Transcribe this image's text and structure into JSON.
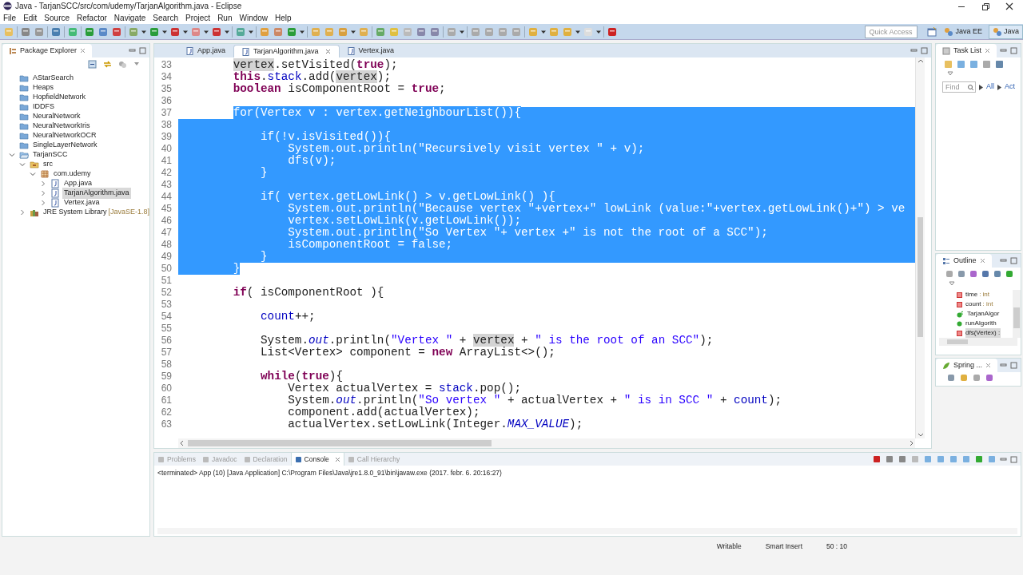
{
  "window": {
    "title": "Java - TarjanSCC/src/com/udemy/TarjanAlgorithm.java - Eclipse"
  },
  "menu": [
    "File",
    "Edit",
    "Source",
    "Refactor",
    "Navigate",
    "Search",
    "Project",
    "Run",
    "Window",
    "Help"
  ],
  "toolbar": {
    "quick_access": {
      "placeholder": "Quick Access"
    },
    "perspectives": [
      {
        "label": "Java EE",
        "selected": false
      },
      {
        "label": "Java",
        "selected": true
      }
    ]
  },
  "package_explorer": {
    "title": "Package Explorer",
    "tree": [
      {
        "label": "AStarSearch",
        "kind": "project"
      },
      {
        "label": "Heaps",
        "kind": "project"
      },
      {
        "label": "HopfieldNetwork",
        "kind": "project"
      },
      {
        "label": "IDDFS",
        "kind": "project"
      },
      {
        "label": "NeuralNetwork",
        "kind": "project"
      },
      {
        "label": "NeuralNetworkIris",
        "kind": "project"
      },
      {
        "label": "NeuralNetworkOCR",
        "kind": "project"
      },
      {
        "label": "SingleLayerNetwork",
        "kind": "project"
      },
      {
        "label": "TarjanSCC",
        "kind": "project",
        "expanded": true,
        "children": [
          {
            "label": "src",
            "kind": "folder",
            "expanded": true,
            "children": [
              {
                "label": "com.udemy",
                "kind": "package",
                "expanded": true,
                "children": [
                  {
                    "label": "App.java",
                    "kind": "file",
                    "expanded": false,
                    "selected": false
                  },
                  {
                    "label": "TarjanAlgorithm.java",
                    "kind": "file",
                    "expanded": false,
                    "selected": true
                  },
                  {
                    "label": "Vertex.java",
                    "kind": "file",
                    "expanded": false,
                    "selected": false
                  }
                ]
              }
            ]
          },
          {
            "label": "JRE System Library",
            "decoration": "[JavaSE-1.8]",
            "kind": "library",
            "expanded": false
          }
        ]
      }
    ]
  },
  "editor": {
    "tabs": [
      {
        "label": "App.java",
        "selected": false
      },
      {
        "label": "TarjanAlgorithm.java",
        "selected": true
      },
      {
        "label": "Vertex.java",
        "selected": false
      }
    ],
    "lines": [
      {
        "number": "33",
        "kind": "plain",
        "segs": [
          {
            "text": "        vertex",
            "kind": "mark"
          },
          {
            "text": ".setVisited(",
            "kind": "plain"
          },
          {
            "text": "true",
            "kind": "keyword"
          },
          {
            "text": ");",
            "kind": "plain"
          }
        ]
      },
      {
        "number": "34",
        "kind": "plain",
        "segs": [
          {
            "text": "        this",
            "kind": "keyword"
          },
          {
            "text": ".",
            "kind": "plain"
          },
          {
            "text": "stack",
            "kind": "field"
          },
          {
            "text": ".add(",
            "kind": "plain"
          },
          {
            "text": "vertex",
            "kind": "mark"
          },
          {
            "text": ");",
            "kind": "plain"
          }
        ]
      },
      {
        "number": "35",
        "kind": "plain",
        "segs": [
          {
            "text": "        boolean",
            "kind": "keyword"
          },
          {
            "text": " isComponentRoot = ",
            "kind": "plain"
          },
          {
            "text": "true",
            "kind": "keyword"
          },
          {
            "text": ";",
            "kind": "plain"
          }
        ]
      },
      {
        "number": "36",
        "kind": "plain"
      },
      {
        "number": "37",
        "kind": "selection-start",
        "segs": [
          {
            "text": "        for(Vertex v : vertex.getNeighbourList()){",
            "kind": "plain"
          }
        ]
      },
      {
        "number": "38",
        "kind": "selected"
      },
      {
        "number": "39",
        "kind": "selected",
        "segs": [
          {
            "text": "            if(!v.isVisited()){",
            "kind": "plain"
          }
        ]
      },
      {
        "number": "40",
        "kind": "selected",
        "segs": [
          {
            "text": "                System.out.println(\"Recursively visit vertex \" + v);",
            "kind": "plain"
          }
        ]
      },
      {
        "number": "41",
        "kind": "selected",
        "segs": [
          {
            "text": "                dfs(v);",
            "kind": "plain"
          }
        ]
      },
      {
        "number": "42",
        "kind": "selected",
        "segs": [
          {
            "text": "            }",
            "kind": "plain"
          }
        ]
      },
      {
        "number": "43",
        "kind": "selected"
      },
      {
        "number": "44",
        "kind": "selected",
        "segs": [
          {
            "text": "            if( vertex.getLowLink() > v.getLowLink() ){",
            "kind": "plain"
          }
        ]
      },
      {
        "number": "45",
        "kind": "selected",
        "segs": [
          {
            "text": "                System.out.println(\"Because vertex \"+vertex+\" lowLink (value:\"+vertex.getLowLink()+\") > ve",
            "kind": "plain"
          }
        ]
      },
      {
        "number": "46",
        "kind": "selected",
        "segs": [
          {
            "text": "                vertex.setLowLink(v.getLowLink());",
            "kind": "plain"
          }
        ]
      },
      {
        "number": "47",
        "kind": "selected",
        "segs": [
          {
            "text": "                System.out.println(\"So Vertex \"+ vertex +\" is not the root of a SCC\");",
            "kind": "plain"
          }
        ]
      },
      {
        "number": "48",
        "kind": "selected",
        "segs": [
          {
            "text": "                isComponentRoot = false;",
            "kind": "plain"
          }
        ]
      },
      {
        "number": "49",
        "kind": "selected",
        "segs": [
          {
            "text": "            }",
            "kind": "plain"
          }
        ]
      },
      {
        "number": "50",
        "kind": "selection-end",
        "segs": [
          {
            "text": "        }",
            "kind": "plain"
          }
        ]
      },
      {
        "number": "51",
        "kind": "plain"
      },
      {
        "number": "52",
        "kind": "plain",
        "segs": [
          {
            "text": "        if",
            "kind": "keyword"
          },
          {
            "text": "( isComponentRoot ){",
            "kind": "plain"
          }
        ]
      },
      {
        "number": "53",
        "kind": "plain"
      },
      {
        "number": "54",
        "kind": "plain",
        "segs": [
          {
            "text": "            count",
            "kind": "field"
          },
          {
            "text": "++;",
            "kind": "plain"
          }
        ]
      },
      {
        "number": "55",
        "kind": "plain"
      },
      {
        "number": "56",
        "kind": "plain",
        "segs": [
          {
            "text": "            System.",
            "kind": "plain"
          },
          {
            "text": "out",
            "kind": "static"
          },
          {
            "text": ".println(",
            "kind": "plain"
          },
          {
            "text": "\"Vertex \"",
            "kind": "string"
          },
          {
            "text": " + ",
            "kind": "plain"
          },
          {
            "text": "vertex",
            "kind": "mark"
          },
          {
            "text": " + ",
            "kind": "plain"
          },
          {
            "text": "\" is the root of an SCC\"",
            "kind": "string"
          },
          {
            "text": ");",
            "kind": "plain"
          }
        ]
      },
      {
        "number": "57",
        "kind": "plain",
        "segs": [
          {
            "text": "            List<Vertex> component = ",
            "kind": "plain"
          },
          {
            "text": "new",
            "kind": "keyword"
          },
          {
            "text": " ArrayList<>();",
            "kind": "plain"
          }
        ]
      },
      {
        "number": "58",
        "kind": "plain"
      },
      {
        "number": "59",
        "kind": "plain",
        "segs": [
          {
            "text": "            while",
            "kind": "keyword"
          },
          {
            "text": "(",
            "kind": "plain"
          },
          {
            "text": "true",
            "kind": "keyword"
          },
          {
            "text": "){",
            "kind": "plain"
          }
        ]
      },
      {
        "number": "60",
        "kind": "plain",
        "segs": [
          {
            "text": "                Vertex actualVertex = ",
            "kind": "plain"
          },
          {
            "text": "stack",
            "kind": "field"
          },
          {
            "text": ".pop();",
            "kind": "plain"
          }
        ]
      },
      {
        "number": "61",
        "kind": "plain",
        "segs": [
          {
            "text": "                System.",
            "kind": "plain"
          },
          {
            "text": "out",
            "kind": "static"
          },
          {
            "text": ".println(",
            "kind": "plain"
          },
          {
            "text": "\"So vertex \"",
            "kind": "string"
          },
          {
            "text": " + actualVertex + ",
            "kind": "plain"
          },
          {
            "text": "\" is in SCC \"",
            "kind": "string"
          },
          {
            "text": " + ",
            "kind": "plain"
          },
          {
            "text": "count",
            "kind": "field"
          },
          {
            "text": ");",
            "kind": "plain"
          }
        ]
      },
      {
        "number": "62",
        "kind": "plain",
        "segs": [
          {
            "text": "                component.add(actualVertex);",
            "kind": "plain"
          }
        ]
      },
      {
        "number": "63",
        "kind": "plain",
        "segs": [
          {
            "text": "                actualVertex.setLowLink(Integer.",
            "kind": "plain"
          },
          {
            "text": "MAX_VALUE",
            "kind": "static"
          },
          {
            "text": ");",
            "kind": "plain"
          }
        ]
      }
    ]
  },
  "task_list": {
    "title": "Task List",
    "find": {
      "placeholder": "Find"
    },
    "filters": [
      "All",
      "Act"
    ]
  },
  "outline": {
    "title": "Outline",
    "items": [
      {
        "label": "time",
        "type": ": int",
        "kind": "private-field",
        "selected": false
      },
      {
        "label": "count",
        "type": ": int",
        "kind": "private-field",
        "selected": false
      },
      {
        "label": "TarjanAlgor",
        "kind": "constructor",
        "selected": false
      },
      {
        "label": "runAlgorith",
        "kind": "public-method",
        "selected": false
      },
      {
        "label": "dfs(Vertex) :",
        "kind": "private-method",
        "selected": true
      }
    ]
  },
  "spring": {
    "title": "Spring ..."
  },
  "console": {
    "tabs": [
      {
        "label": "Problems",
        "selected": false
      },
      {
        "label": "Javadoc",
        "selected": false
      },
      {
        "label": "Declaration",
        "selected": false
      },
      {
        "label": "Console",
        "selected": true
      },
      {
        "label": "Call Hierarchy",
        "selected": false
      }
    ],
    "text": "<terminated> App (10) [Java Application] C:\\Program Files\\Java\\jre1.8.0_91\\bin\\javaw.exe (2017. febr. 6. 20:16:27)"
  },
  "status_bar": [
    "Writable",
    "Smart Insert",
    "50 : 10"
  ]
}
